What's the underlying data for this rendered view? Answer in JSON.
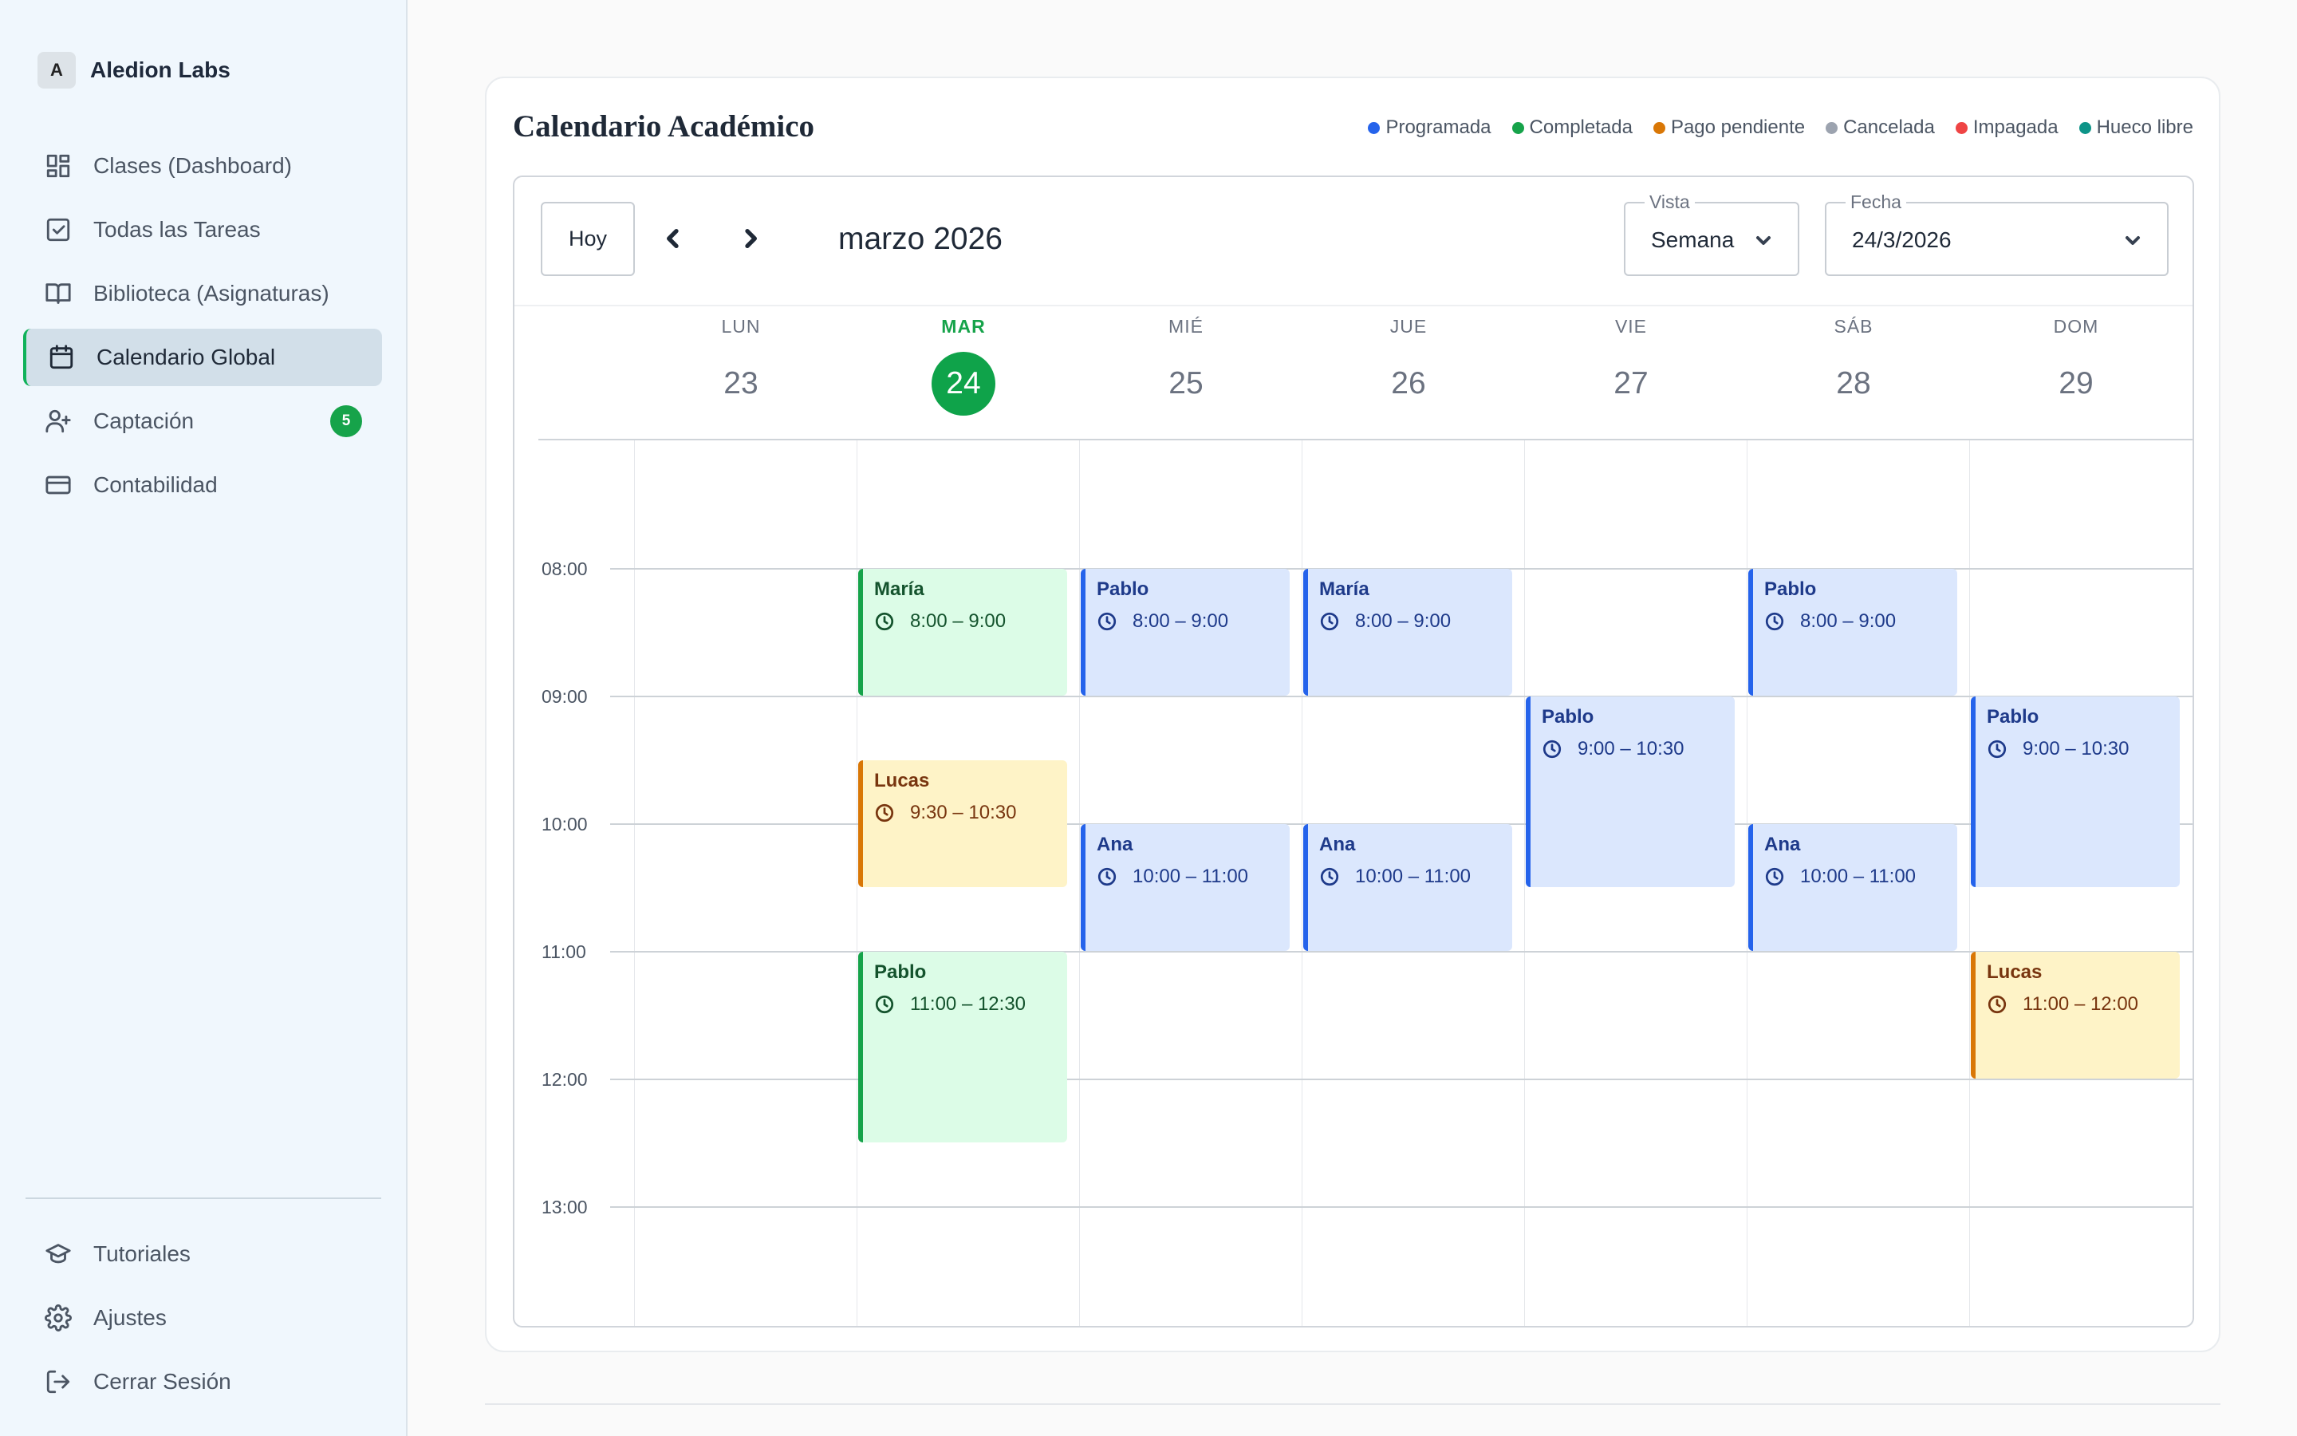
{
  "app": {
    "initial": "A",
    "name": "Aledion Labs"
  },
  "sidebar": {
    "items": [
      {
        "label": "Clases (Dashboard)",
        "icon": "dashboard-icon"
      },
      {
        "label": "Todas las Tareas",
        "icon": "checkbox-icon"
      },
      {
        "label": "Biblioteca (Asignaturas)",
        "icon": "book-icon"
      },
      {
        "label": "Calendario Global",
        "icon": "calendar-icon",
        "active": true
      },
      {
        "label": "Captación",
        "icon": "user-plus-icon",
        "badge": "5"
      },
      {
        "label": "Contabilidad",
        "icon": "credit-card-icon"
      }
    ],
    "bottom": [
      {
        "label": "Tutoriales",
        "icon": "graduation-cap-icon"
      },
      {
        "label": "Ajustes",
        "icon": "gear-icon"
      },
      {
        "label": "Cerrar Sesión",
        "icon": "logout-icon"
      }
    ]
  },
  "calendar": {
    "title": "Calendario Académico",
    "legend": [
      {
        "label": "Programada",
        "color": "#2563eb"
      },
      {
        "label": "Completada",
        "color": "#16a34a"
      },
      {
        "label": "Pago pendiente",
        "color": "#d97706"
      },
      {
        "label": "Cancelada",
        "color": "#9ca3af"
      },
      {
        "label": "Impagada",
        "color": "#ef4444"
      },
      {
        "label": "Hueco libre",
        "color": "#0d9488"
      }
    ],
    "toolbar": {
      "today_label": "Hoy",
      "month_label": "marzo 2026",
      "view_label": "Vista",
      "view_value": "Semana",
      "date_label": "Fecha",
      "date_value": "24/3/2026"
    },
    "days": [
      {
        "name": "LUN",
        "num": "23"
      },
      {
        "name": "MAR",
        "num": "24",
        "today": true
      },
      {
        "name": "MIÉ",
        "num": "25"
      },
      {
        "name": "JUE",
        "num": "26"
      },
      {
        "name": "VIE",
        "num": "27"
      },
      {
        "name": "SÁB",
        "num": "28"
      },
      {
        "name": "DOM",
        "num": "29"
      }
    ],
    "hours": [
      "08:00",
      "09:00",
      "10:00",
      "11:00",
      "12:00",
      "13:00"
    ],
    "events": [
      {
        "day": 1,
        "start": 8,
        "end": 9,
        "name": "María",
        "time": "8:00 – 9:00",
        "status": "completed"
      },
      {
        "day": 1,
        "start": 9.5,
        "end": 10.5,
        "name": "Lucas",
        "time": "9:30 – 10:30",
        "status": "pending"
      },
      {
        "day": 1,
        "start": 11,
        "end": 12.5,
        "name": "Pablo",
        "time": "11:00 – 12:30",
        "status": "completed"
      },
      {
        "day": 2,
        "start": 8,
        "end": 9,
        "name": "Pablo",
        "time": "8:00 – 9:00",
        "status": "scheduled"
      },
      {
        "day": 2,
        "start": 10,
        "end": 11,
        "name": "Ana",
        "time": "10:00 – 11:00",
        "status": "scheduled"
      },
      {
        "day": 3,
        "start": 8,
        "end": 9,
        "name": "María",
        "time": "8:00 – 9:00",
        "status": "scheduled"
      },
      {
        "day": 3,
        "start": 10,
        "end": 11,
        "name": "Ana",
        "time": "10:00 – 11:00",
        "status": "scheduled"
      },
      {
        "day": 4,
        "start": 9,
        "end": 10.5,
        "name": "Pablo",
        "time": "9:00 – 10:30",
        "status": "scheduled"
      },
      {
        "day": 5,
        "start": 8,
        "end": 9,
        "name": "Pablo",
        "time": "8:00 – 9:00",
        "status": "scheduled"
      },
      {
        "day": 5,
        "start": 10,
        "end": 11,
        "name": "Ana",
        "time": "10:00 – 11:00",
        "status": "scheduled"
      },
      {
        "day": 6,
        "start": 9,
        "end": 10.5,
        "name": "Pablo",
        "time": "9:00 – 10:30",
        "status": "scheduled"
      },
      {
        "day": 6,
        "start": 11,
        "end": 12,
        "name": "Lucas",
        "time": "11:00 – 12:00",
        "status": "pending"
      }
    ]
  }
}
